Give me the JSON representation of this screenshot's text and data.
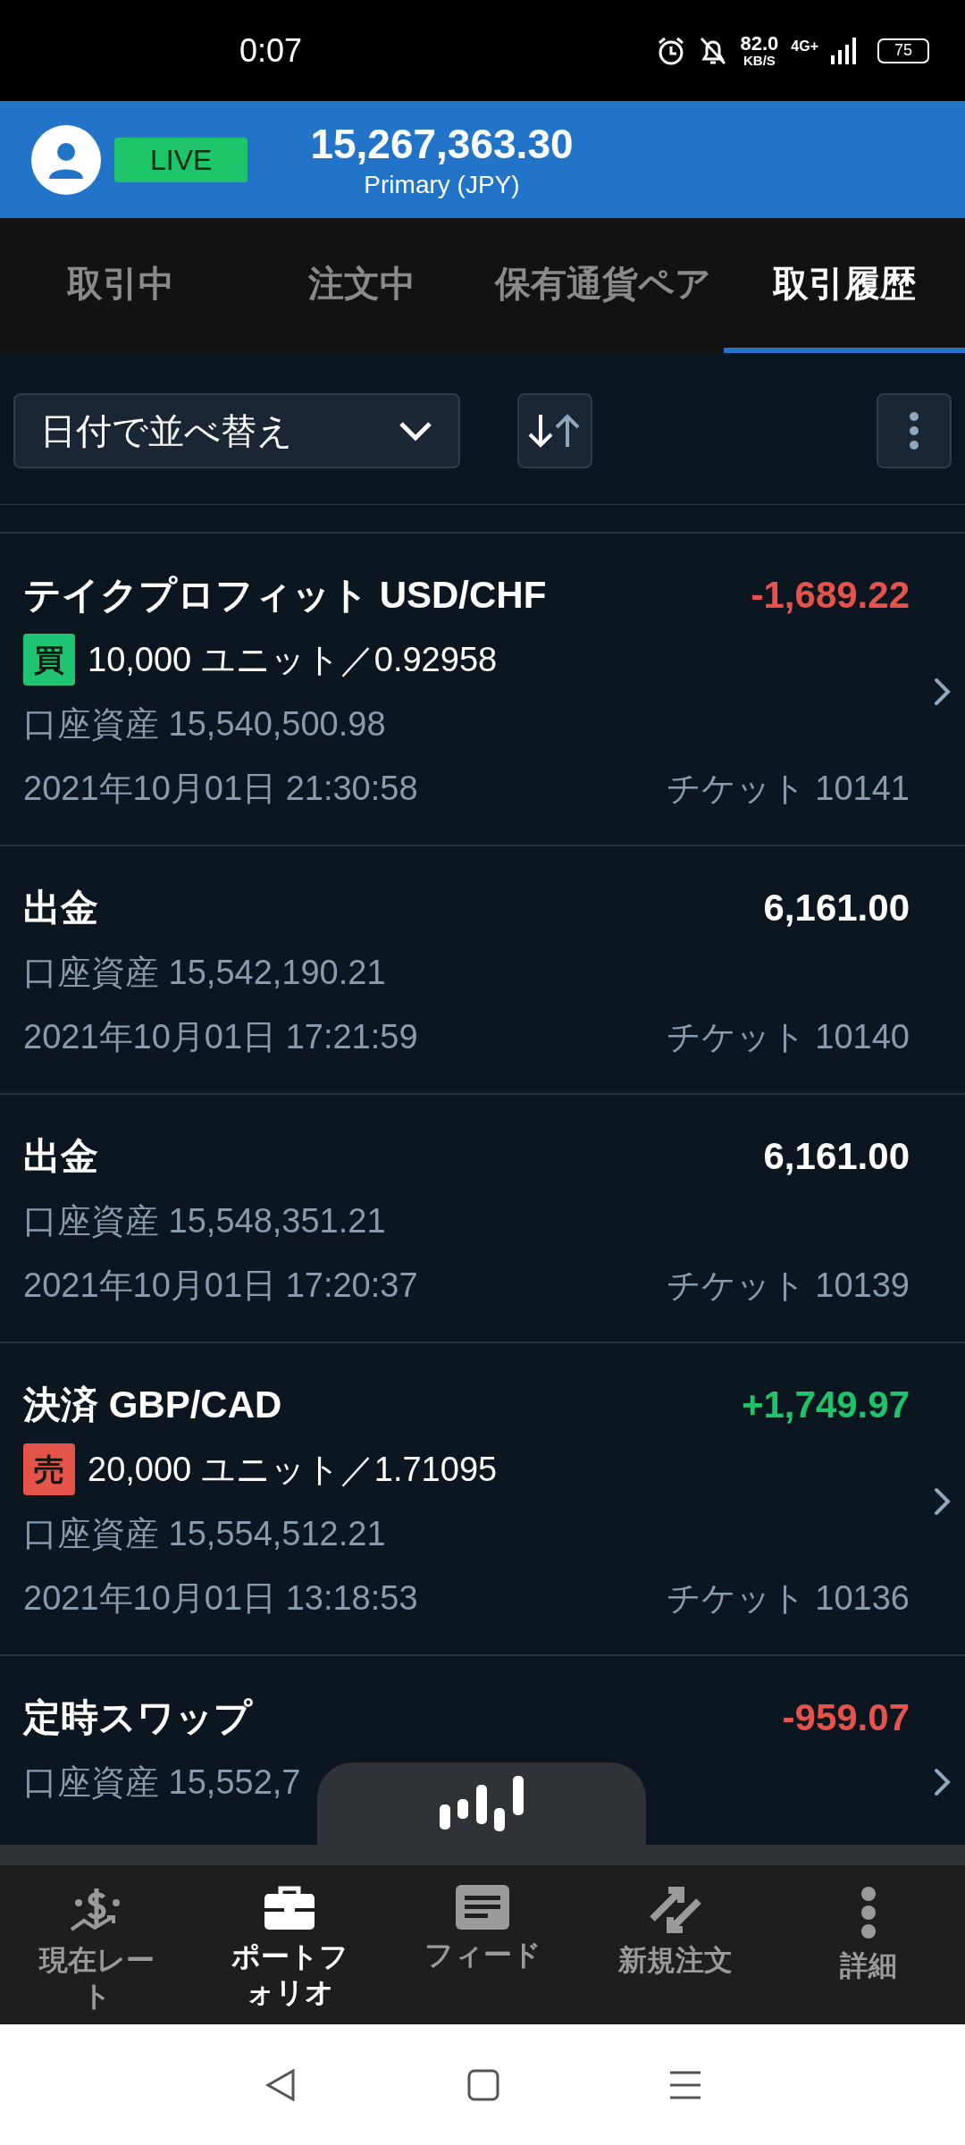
{
  "status_bar": {
    "time": "0:07",
    "speed": "82.0",
    "speed_unit": "KB/S",
    "network": "4G+",
    "battery": "75"
  },
  "header": {
    "badge": "LIVE",
    "balance": "15,267,363.30",
    "account": "Primary (JPY)"
  },
  "tabs": [
    {
      "label": "取引中",
      "selected": false
    },
    {
      "label": "注文中",
      "selected": false
    },
    {
      "label": "保有通貨ペア",
      "selected": false
    },
    {
      "label": "取引履歴",
      "selected": true
    }
  ],
  "toolbar": {
    "sort_label": "日付で並べ替え"
  },
  "rows": [
    {
      "kind": "trade",
      "title": "テイクプロフィット USD/CHF",
      "amount": "-1,689.22",
      "color": "#e5534b",
      "side": {
        "label": "買",
        "color": "#1ec472"
      },
      "units": "10,000 ユニット／0.92958",
      "equity": "口座資産 15,540,500.98",
      "date": "2021年10月01日 21:30:58",
      "ticket": "チケット 10141"
    },
    {
      "kind": "plain",
      "title": "出金",
      "amount": "6,161.00",
      "color": "#ffffff",
      "equity": "口座資産 15,542,190.21",
      "date": "2021年10月01日 17:21:59",
      "ticket": "チケット 10140"
    },
    {
      "kind": "plain",
      "title": "出金",
      "amount": "6,161.00",
      "color": "#ffffff",
      "equity": "口座資産 15,548,351.21",
      "date": "2021年10月01日 17:20:37",
      "ticket": "チケット 10139"
    },
    {
      "kind": "trade",
      "title": "決済 GBP/CAD",
      "amount": "+1,749.97",
      "color": "#1fc46a",
      "side": {
        "label": "売",
        "color": "#e5534b"
      },
      "units": "20,000 ユニット／1.71095",
      "equity": "口座資産 15,554,512.21",
      "date": "2021年10月01日 13:18:53",
      "ticket": "チケット 10136"
    },
    {
      "kind": "chevron",
      "title": "定時スワップ",
      "amount": "-959.07",
      "color": "#e5534b",
      "equity": "口座資産 15,552,7"
    }
  ],
  "nav": [
    {
      "label": "現在レート",
      "selected": false
    },
    {
      "label": "ポートフォリオ",
      "selected": true
    },
    {
      "label": "フィード",
      "selected": false
    },
    {
      "label": "新規注文",
      "selected": false
    },
    {
      "label": "詳細",
      "selected": false
    }
  ]
}
